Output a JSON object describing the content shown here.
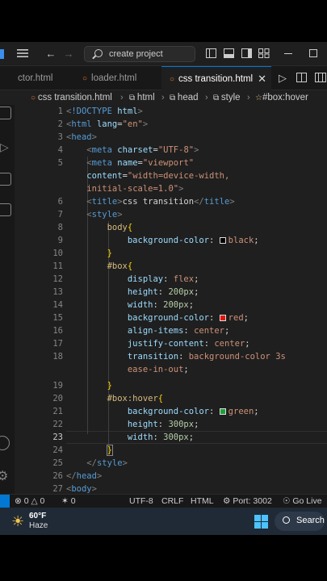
{
  "window": {
    "search_placeholder": "create project"
  },
  "tabs": [
    {
      "label": "ctor.html"
    },
    {
      "label": "loader.html"
    },
    {
      "label": "css transition.html",
      "active": true
    }
  ],
  "breadcrumbs": [
    "css transition.html",
    "html",
    "head",
    "style",
    "#box:hover"
  ],
  "editor": {
    "line_numbers": [
      "1",
      "2",
      "3",
      "4",
      "5",
      "",
      "6",
      "7",
      "8",
      "9",
      "10",
      "11",
      "12",
      "13",
      "14",
      "15",
      "16",
      "17",
      "18",
      "",
      "19",
      "20",
      "21",
      "22",
      "23",
      "24",
      "25",
      "26",
      "27"
    ],
    "current_line": "23",
    "lines": [
      "<!DOCTYPE html>",
      "<html lang=\"en\">",
      "<head>",
      "<meta charset=\"UTF-8\">",
      "<meta name=\"viewport\"",
      "content=\"width=device-width,",
      "initial-scale=1.0\">",
      "<title>css transition</title>",
      "<style>",
      "body{",
      "background-color: black;",
      "}",
      "#box{",
      "display: flex;",
      "height: 200px;",
      "width: 200px;",
      "background-color: red;",
      "align-items: center;",
      "justify-content: center;",
      "transition: background-color 3s",
      "ease-in-out;",
      "}",
      "#box:hover{",
      "background-color: green;",
      "height: 300px;",
      "width: 300px;",
      "}",
      "</style>",
      "</head>",
      "<body>"
    ],
    "swatch_colors": {
      "black": "#000000",
      "red": "#e51400",
      "green": "#1e9e3a"
    }
  },
  "statusbar": {
    "errors": "0",
    "warnings": "0",
    "ports": "0",
    "encoding": "UTF-8",
    "eol": "CRLF",
    "language": "HTML",
    "port": "Port: 3002",
    "golive": "Go Live"
  },
  "taskbar": {
    "temperature": "60°F",
    "weather": "Haze",
    "search": "Search"
  },
  "colors": {
    "accent": "#0078d4",
    "editor_bg": "#1f1f1f"
  }
}
